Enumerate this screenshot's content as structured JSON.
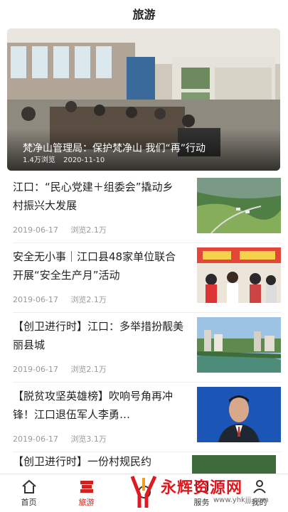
{
  "header": {
    "title": "旅游"
  },
  "hero": {
    "title": "梵净山管理局：保护梵净山 我们“再”行动",
    "views": "1.4万浏览",
    "date": "2020-11-10"
  },
  "articles": [
    {
      "title": "江口：“民心党建＋组委会”撬动乡村振兴大发展",
      "date": "2019-06-17",
      "views": "浏览2.1万",
      "thumb": "village-aerial"
    },
    {
      "title": "安全无小事｜江口县48家单位联合开展“安全生产月”活动",
      "date": "2019-06-17",
      "views": "浏览2.1万",
      "thumb": "safety-event"
    },
    {
      "title": "【创卫进行时】江口：多举措扮靓美丽县城",
      "date": "2019-06-17",
      "views": "浏览2.1万",
      "thumb": "city-river"
    },
    {
      "title": "【脱贫攻坚英雄榜】吹响号角再冲锋！江口退伍军人李勇…",
      "date": "2019-06-17",
      "views": "浏览3.1万",
      "thumb": "portrait"
    }
  ],
  "partial_article": {
    "title": "【创卫进行时】一份村规民约"
  },
  "tabbar": {
    "items": [
      {
        "label": "首页",
        "icon": "home-icon"
      },
      {
        "label": "旅游",
        "icon": "travel-icon"
      },
      {
        "label": "",
        "icon": "center-icon"
      },
      {
        "label": "服务",
        "icon": "service-icon"
      },
      {
        "label": "我的",
        "icon": "user-icon"
      }
    ],
    "active_color": "#d0221c"
  },
  "watermark": {
    "text": "永辉资源网",
    "url": "www.yhkjjj.com"
  }
}
